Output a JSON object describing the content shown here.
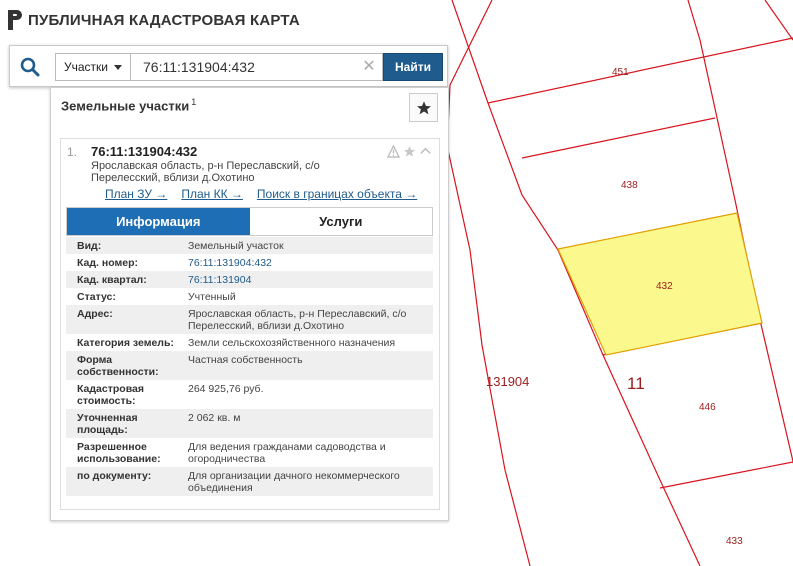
{
  "header": {
    "title": "ПУБЛИЧНАЯ КАДАСТРОВАЯ КАРТА"
  },
  "search": {
    "type_label": "Участки",
    "query": "76:11:131904:432",
    "button_label": "Найти"
  },
  "panel": {
    "title": "Земельные участки",
    "count": "1"
  },
  "result": {
    "number": "1.",
    "cadastral_number": "76:11:131904:432",
    "address": "Ярославская область, р-н Переславский, с/о Перелесский, вблизи д.Охотино",
    "links": [
      "План ЗУ →",
      "План КК →",
      "Поиск в границах объекта →"
    ],
    "tabs": [
      "Информация",
      "Услуги"
    ],
    "fields": [
      {
        "key": "Вид:",
        "value": "Земельный участок"
      },
      {
        "key": "Кад. номер:",
        "value": "76:11:131904:432"
      },
      {
        "key": "Кад. квартал:",
        "value": "76:11:131904"
      },
      {
        "key": "Статус:",
        "value": "Учтенный"
      },
      {
        "key": "Адрес:",
        "value": "Ярославская область, р-н Переславский, с/о Перелесский, вблизи д.Охотино"
      },
      {
        "key": "Категория земель:",
        "value": "Земли сельскохозяйственного назначения"
      },
      {
        "key": "Форма собственности:",
        "value": "Частная собственность"
      },
      {
        "key": "Кадастровая стоимость:",
        "value": "264 925,76 руб."
      },
      {
        "key": "Уточненная площадь:",
        "value": "2 062 кв. м"
      },
      {
        "key": "Разрешенное использование:",
        "value": "Для ведения гражданами садоводства и огородничества"
      },
      {
        "key": "по документу:",
        "value": "Для организации дачного некоммерческого объединения"
      }
    ]
  },
  "map": {
    "labels": {
      "p451": "451",
      "p438": "438",
      "p432": "432",
      "p446": "446",
      "p433": "433",
      "quarter": "131904",
      "block": "11"
    },
    "colors": {
      "boundary": "#d8141e",
      "highlight_fill": "#fbf98e",
      "highlight_stroke": "#e0a000",
      "label": "#9b1c1c"
    }
  },
  "icons": {
    "logo": "logo-icon",
    "search": "search-icon",
    "clear": "clear-icon",
    "star": "star-icon",
    "warning": "warning-icon",
    "chevron": "chevron-up-icon"
  }
}
